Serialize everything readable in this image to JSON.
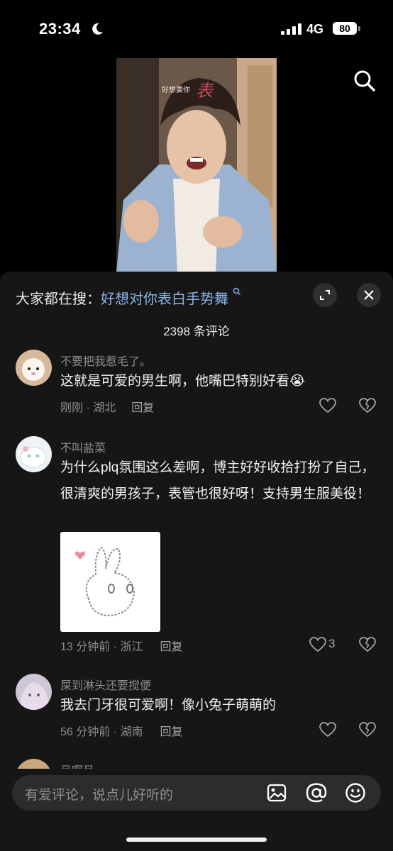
{
  "status": {
    "time": "23:34",
    "network": "4G",
    "battery": "80"
  },
  "video": {
    "overlay_small": "好想要你",
    "overlay_big": "表"
  },
  "sheet": {
    "hot_prefix": "大家都在搜：",
    "hot_keyword": "好想对你表白手势舞",
    "comment_count": "2398 条评论"
  },
  "comments": [
    {
      "user": "不要把我惹毛了。",
      "text": "这就是可爱的男生啊，他嘴巴特别好看😭",
      "meta": "刚刚 · 湖北",
      "reply": "回复",
      "likes": ""
    },
    {
      "user": "不叫盐菜",
      "text": "为什么plq氛围这么差啊，博主好好收拾打扮了自己，很清爽的男孩子，表管也很好呀！支持男生服美役！",
      "meta": "13 分钟前 · 浙江",
      "reply": "回复",
      "likes": "3"
    },
    {
      "user": "屎到淋头还要搅便",
      "text": "我去门牙很可爱啊！像小兔子萌萌的",
      "meta": "56 分钟前 · 湖南",
      "reply": "回复",
      "likes": ""
    },
    {
      "user": "吕啊吕"
    }
  ],
  "input": {
    "placeholder": "有爱评论，说点儿好听的"
  },
  "icons": [
    "search-icon",
    "moon-icon",
    "expand-icon",
    "close-icon",
    "heart-icon",
    "broken-heart-icon",
    "image-icon",
    "at-icon",
    "emoji-icon"
  ],
  "colors": {
    "sheet_bg": "#161616",
    "keyword": "#8ab4ea",
    "muted": "#8c8c8c"
  }
}
